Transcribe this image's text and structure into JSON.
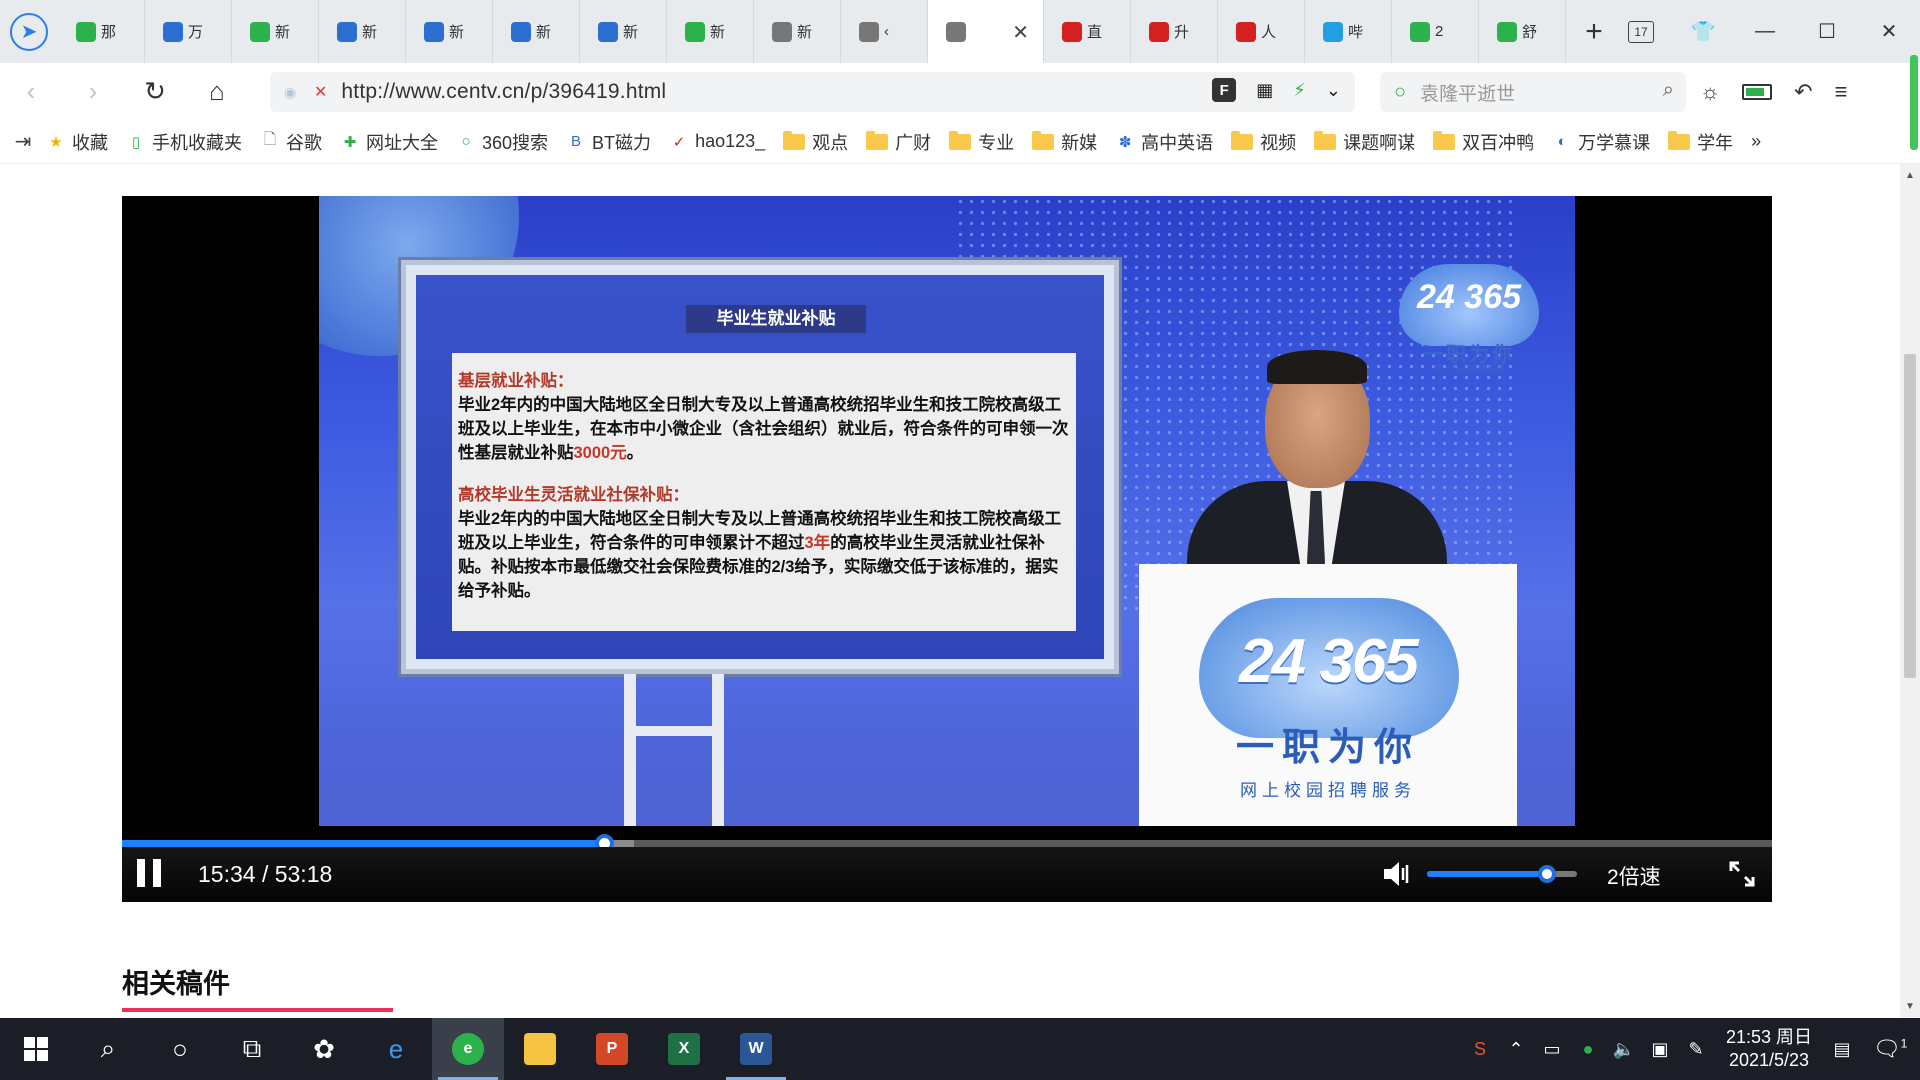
{
  "browser": {
    "tabs": [
      {
        "label": "那",
        "icon": "play-icon",
        "color": "#2cb24a",
        "active": false
      },
      {
        "label": "万",
        "icon": "globe-icon",
        "color": "#2c6fd1",
        "active": false
      },
      {
        "label": "新",
        "icon": "360-search-icon",
        "color": "#2cb24a",
        "active": false
      },
      {
        "label": "新",
        "icon": "news-icon",
        "color": "#2c6fd1",
        "active": false
      },
      {
        "label": "新",
        "icon": "news-icon",
        "color": "#2c6fd1",
        "active": false
      },
      {
        "label": "新",
        "icon": "news-icon",
        "color": "#2c6fd1",
        "active": false
      },
      {
        "label": "新",
        "icon": "news-icon",
        "color": "#2c6fd1",
        "active": false
      },
      {
        "label": "新",
        "icon": "360-search-icon",
        "color": "#2cb24a",
        "active": false
      },
      {
        "label": "新",
        "icon": "page-icon",
        "color": "#777777",
        "active": false
      },
      {
        "label": "‹",
        "icon": "page-icon",
        "color": "#777777",
        "active": false
      },
      {
        "label": "",
        "icon": "page-icon",
        "color": "#777777",
        "active": true
      },
      {
        "label": "直",
        "icon": "cctv-icon",
        "color": "#d52020",
        "active": false
      },
      {
        "label": "升",
        "icon": "dots-icon",
        "color": "#d52020",
        "active": false
      },
      {
        "label": "人",
        "icon": "play-red-icon",
        "color": "#d52020",
        "active": false
      },
      {
        "label": "哔",
        "icon": "bilibili-icon",
        "color": "#20a0e0",
        "active": false
      },
      {
        "label": "2",
        "icon": "360-search-icon",
        "color": "#2cb24a",
        "active": false
      },
      {
        "label": "舒",
        "icon": "play-icon",
        "color": "#2cb24a",
        "active": false
      }
    ],
    "new_tab": "+",
    "tab_count": "17",
    "url": "http://www.centv.cn/p/396419.html",
    "search_placeholder": "袁隆平逝世",
    "bookmarks": [
      {
        "label": "收藏",
        "kind": "star-icon"
      },
      {
        "label": "手机收藏夹",
        "kind": "phone-icon"
      },
      {
        "label": "谷歌",
        "kind": "page-icon"
      },
      {
        "label": "网址大全",
        "kind": "cross-icon"
      },
      {
        "label": "360搜索",
        "kind": "360-icon"
      },
      {
        "label": "BT磁力",
        "kind": "bt-icon"
      },
      {
        "label": "hao123_",
        "kind": "hao-icon"
      },
      {
        "label": "观点",
        "kind": "folder"
      },
      {
        "label": "广财",
        "kind": "folder"
      },
      {
        "label": "专业",
        "kind": "folder"
      },
      {
        "label": "新媒",
        "kind": "folder"
      },
      {
        "label": "高中英语",
        "kind": "paw-icon"
      },
      {
        "label": "视频",
        "kind": "folder"
      },
      {
        "label": "课题啊谋",
        "kind": "folder"
      },
      {
        "label": "双百冲鸭",
        "kind": "folder"
      },
      {
        "label": "万学慕课",
        "kind": "globe-icon"
      },
      {
        "label": "学年",
        "kind": "folder"
      }
    ],
    "bookmarks_more": "»"
  },
  "video": {
    "board_title": "毕业生就业补贴",
    "section1_head": "基层就业补贴：",
    "section1_body": "毕业2年内的中国大陆地区全日制大专及以上普通高校统招毕业生和技工院校高级工班及以上毕业生，在本市中小微企业（含社会组织）就业后，符合条件的可申领一次性基层就业补贴",
    "section1_amount": "3000元",
    "section1_end": "。",
    "section2_head": "高校毕业生灵活就业社保补贴：",
    "section2_body_a": "毕业2年内的中国大陆地区全日制大专及以上普通高校统招毕业生和技工院校高级工班及以上毕业生，符合条件的可申领累计不超过",
    "section2_years": "3年",
    "section2_body_b": "的高校毕业生灵活就业社保补贴。补贴按本市最低缴交社会保险费标准的2/3给予，实际缴交低于该标准的，据实给予补贴。",
    "logo_number": "24 365",
    "logo_slogan": "一职为你",
    "logo_sub": "网上校园招聘服务",
    "corner_number": "24 365",
    "corner_slogan": "一职为你",
    "corner_sub": "网上校园招聘服务",
    "time_display": "15:34 / 53:18",
    "played_fraction": 0.292,
    "buffered_fraction": 0.31,
    "volume_fraction": 0.8,
    "speed_label": "2倍速"
  },
  "page": {
    "related_title": "相关稿件"
  },
  "taskbar": {
    "clock_time": "21:53 周日",
    "clock_date": "2021/5/23",
    "notif_count": "1"
  }
}
